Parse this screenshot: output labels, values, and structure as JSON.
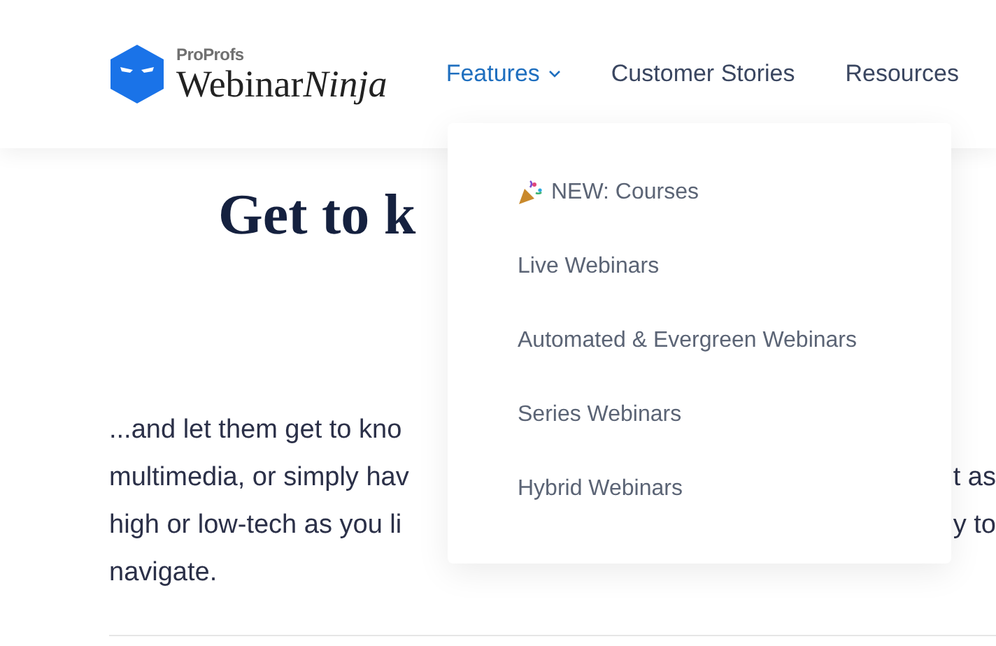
{
  "header": {
    "logo": {
      "brand": "ProProfs",
      "name": "Webinar",
      "name_italic": "Ninja"
    },
    "nav": [
      {
        "label": "Features",
        "selected": true,
        "dropdown": true
      },
      {
        "label": "Customer Stories",
        "selected": false,
        "dropdown": false
      },
      {
        "label": "Resources",
        "selected": false,
        "dropdown": false
      }
    ]
  },
  "content": {
    "heading": "Get to k",
    "paragraph_lines": [
      {
        "left": "...and let them get to kno"
      },
      {
        "left": "multimedia, or simply hav",
        "right": "t as"
      },
      {
        "left": "high or low-tech as you li",
        "right": "y to"
      },
      {
        "left": "navigate."
      }
    ]
  },
  "features_menu": [
    {
      "label": "NEW: Courses",
      "kind": "featured"
    },
    {
      "label": "Live Webinars",
      "kind": "link"
    },
    {
      "label": "Automated & Evergreen Webinars",
      "kind": "link"
    },
    {
      "label": "Series Webinars",
      "kind": "link"
    },
    {
      "label": "Hybrid Webinars",
      "kind": "link"
    }
  ]
}
